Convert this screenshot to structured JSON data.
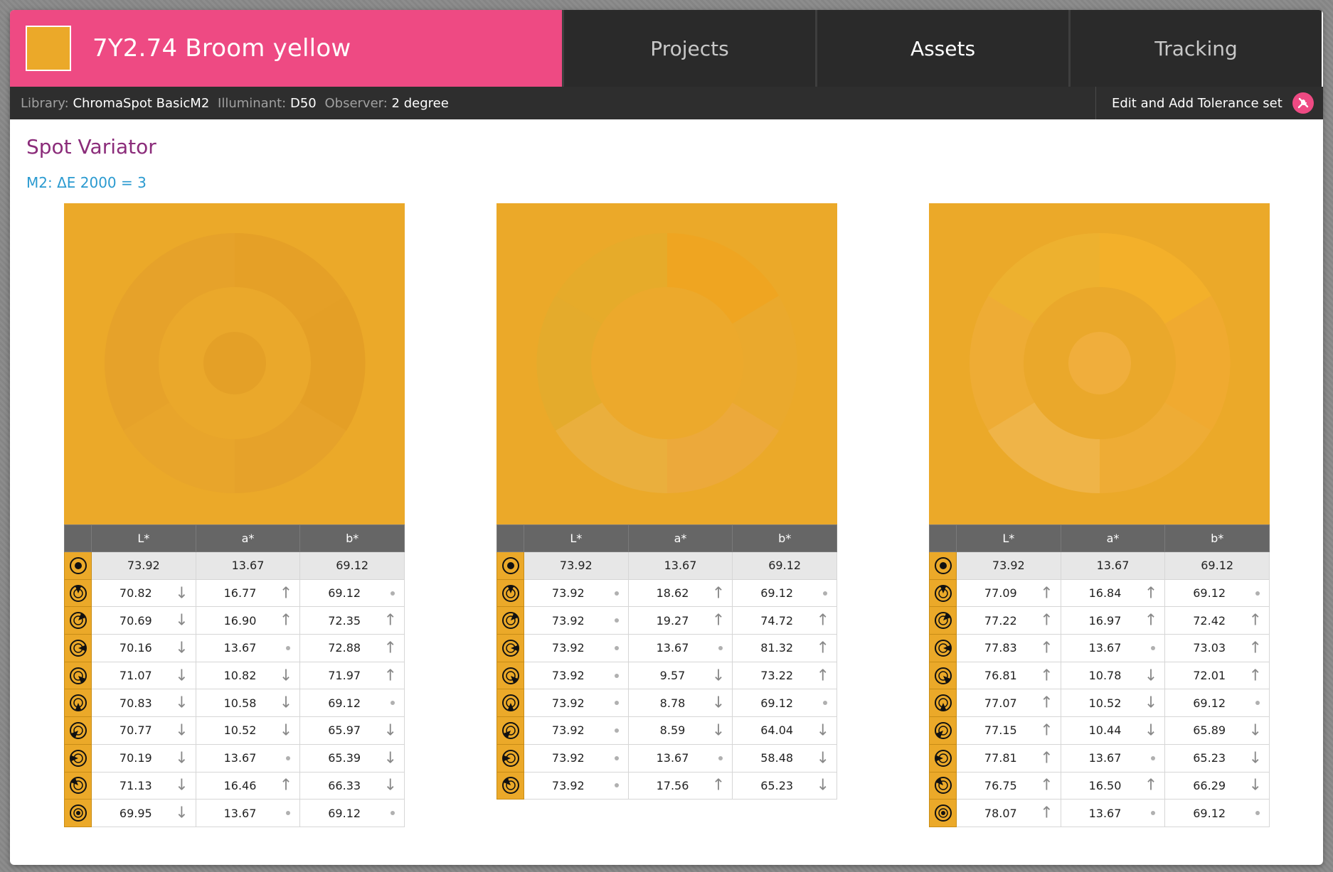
{
  "header": {
    "title": "7Y2.74 Broom yellow",
    "swatch_color": "#eba929",
    "brand_color": "#ee4a83"
  },
  "nav": {
    "tabs": [
      {
        "label": "Projects",
        "active": false
      },
      {
        "label": "Assets",
        "active": true
      },
      {
        "label": "Tracking",
        "active": false
      }
    ]
  },
  "subbar": {
    "library_label": "Library:",
    "library_value": "ChromaSpot BasicM2",
    "illuminant_label": "Illuminant:",
    "illuminant_value": "D50",
    "observer_label": "Observer:",
    "observer_value": "2 degree",
    "tolerance_button": "Edit and Add Tolerance set",
    "tolerance_icon": "tools-icon"
  },
  "page": {
    "title": "Spot Variator",
    "formula": "M2: ΔE 2000 = 3"
  },
  "columns": [
    "L*",
    "a*",
    "b*"
  ],
  "variants": [
    {
      "rows": [
        {
          "L": "73.92",
          "a": "13.67",
          "b": "69.12",
          "ref": true
        },
        {
          "L": "70.82",
          "Ld": "down",
          "a": "16.77",
          "ad": "up",
          "b": "69.12",
          "bd": "same"
        },
        {
          "L": "70.69",
          "Ld": "down",
          "a": "16.90",
          "ad": "up",
          "b": "72.35",
          "bd": "up"
        },
        {
          "L": "70.16",
          "Ld": "down",
          "a": "13.67",
          "ad": "same",
          "b": "72.88",
          "bd": "up"
        },
        {
          "L": "71.07",
          "Ld": "down",
          "a": "10.82",
          "ad": "down",
          "b": "71.97",
          "bd": "up"
        },
        {
          "L": "70.83",
          "Ld": "down",
          "a": "10.58",
          "ad": "down",
          "b": "69.12",
          "bd": "same"
        },
        {
          "L": "70.77",
          "Ld": "down",
          "a": "10.52",
          "ad": "down",
          "b": "65.97",
          "bd": "down"
        },
        {
          "L": "70.19",
          "Ld": "down",
          "a": "13.67",
          "ad": "same",
          "b": "65.39",
          "bd": "down"
        },
        {
          "L": "71.13",
          "Ld": "down",
          "a": "16.46",
          "ad": "up",
          "b": "66.33",
          "bd": "down"
        },
        {
          "L": "69.95",
          "Ld": "down",
          "a": "13.67",
          "ad": "same",
          "b": "69.12",
          "bd": "same"
        }
      ]
    },
    {
      "rows": [
        {
          "L": "73.92",
          "a": "13.67",
          "b": "69.12",
          "ref": true
        },
        {
          "L": "73.92",
          "Ld": "same",
          "a": "18.62",
          "ad": "up",
          "b": "69.12",
          "bd": "same"
        },
        {
          "L": "73.92",
          "Ld": "same",
          "a": "19.27",
          "ad": "up",
          "b": "74.72",
          "bd": "up"
        },
        {
          "L": "73.92",
          "Ld": "same",
          "a": "13.67",
          "ad": "same",
          "b": "81.32",
          "bd": "up"
        },
        {
          "L": "73.92",
          "Ld": "same",
          "a": "9.57",
          "ad": "down",
          "b": "73.22",
          "bd": "up"
        },
        {
          "L": "73.92",
          "Ld": "same",
          "a": "8.78",
          "ad": "down",
          "b": "69.12",
          "bd": "same"
        },
        {
          "L": "73.92",
          "Ld": "same",
          "a": "8.59",
          "ad": "down",
          "b": "64.04",
          "bd": "down"
        },
        {
          "L": "73.92",
          "Ld": "same",
          "a": "13.67",
          "ad": "same",
          "b": "58.48",
          "bd": "down"
        },
        {
          "L": "73.92",
          "Ld": "same",
          "a": "17.56",
          "ad": "up",
          "b": "65.23",
          "bd": "down"
        }
      ]
    },
    {
      "rows": [
        {
          "L": "73.92",
          "a": "13.67",
          "b": "69.12",
          "ref": true
        },
        {
          "L": "77.09",
          "Ld": "up",
          "a": "16.84",
          "ad": "up",
          "b": "69.12",
          "bd": "same"
        },
        {
          "L": "77.22",
          "Ld": "up",
          "a": "16.97",
          "ad": "up",
          "b": "72.42",
          "bd": "up"
        },
        {
          "L": "77.83",
          "Ld": "up",
          "a": "13.67",
          "ad": "same",
          "b": "73.03",
          "bd": "up"
        },
        {
          "L": "76.81",
          "Ld": "up",
          "a": "10.78",
          "ad": "down",
          "b": "72.01",
          "bd": "up"
        },
        {
          "L": "77.07",
          "Ld": "up",
          "a": "10.52",
          "ad": "down",
          "b": "69.12",
          "bd": "same"
        },
        {
          "L": "77.15",
          "Ld": "up",
          "a": "10.44",
          "ad": "down",
          "b": "65.89",
          "bd": "down"
        },
        {
          "L": "77.81",
          "Ld": "up",
          "a": "13.67",
          "ad": "same",
          "b": "65.23",
          "bd": "down"
        },
        {
          "L": "76.75",
          "Ld": "up",
          "a": "16.50",
          "ad": "up",
          "b": "66.29",
          "bd": "down"
        },
        {
          "L": "78.07",
          "Ld": "up",
          "a": "13.67",
          "ad": "same",
          "b": "69.12",
          "bd": "same"
        }
      ]
    }
  ]
}
